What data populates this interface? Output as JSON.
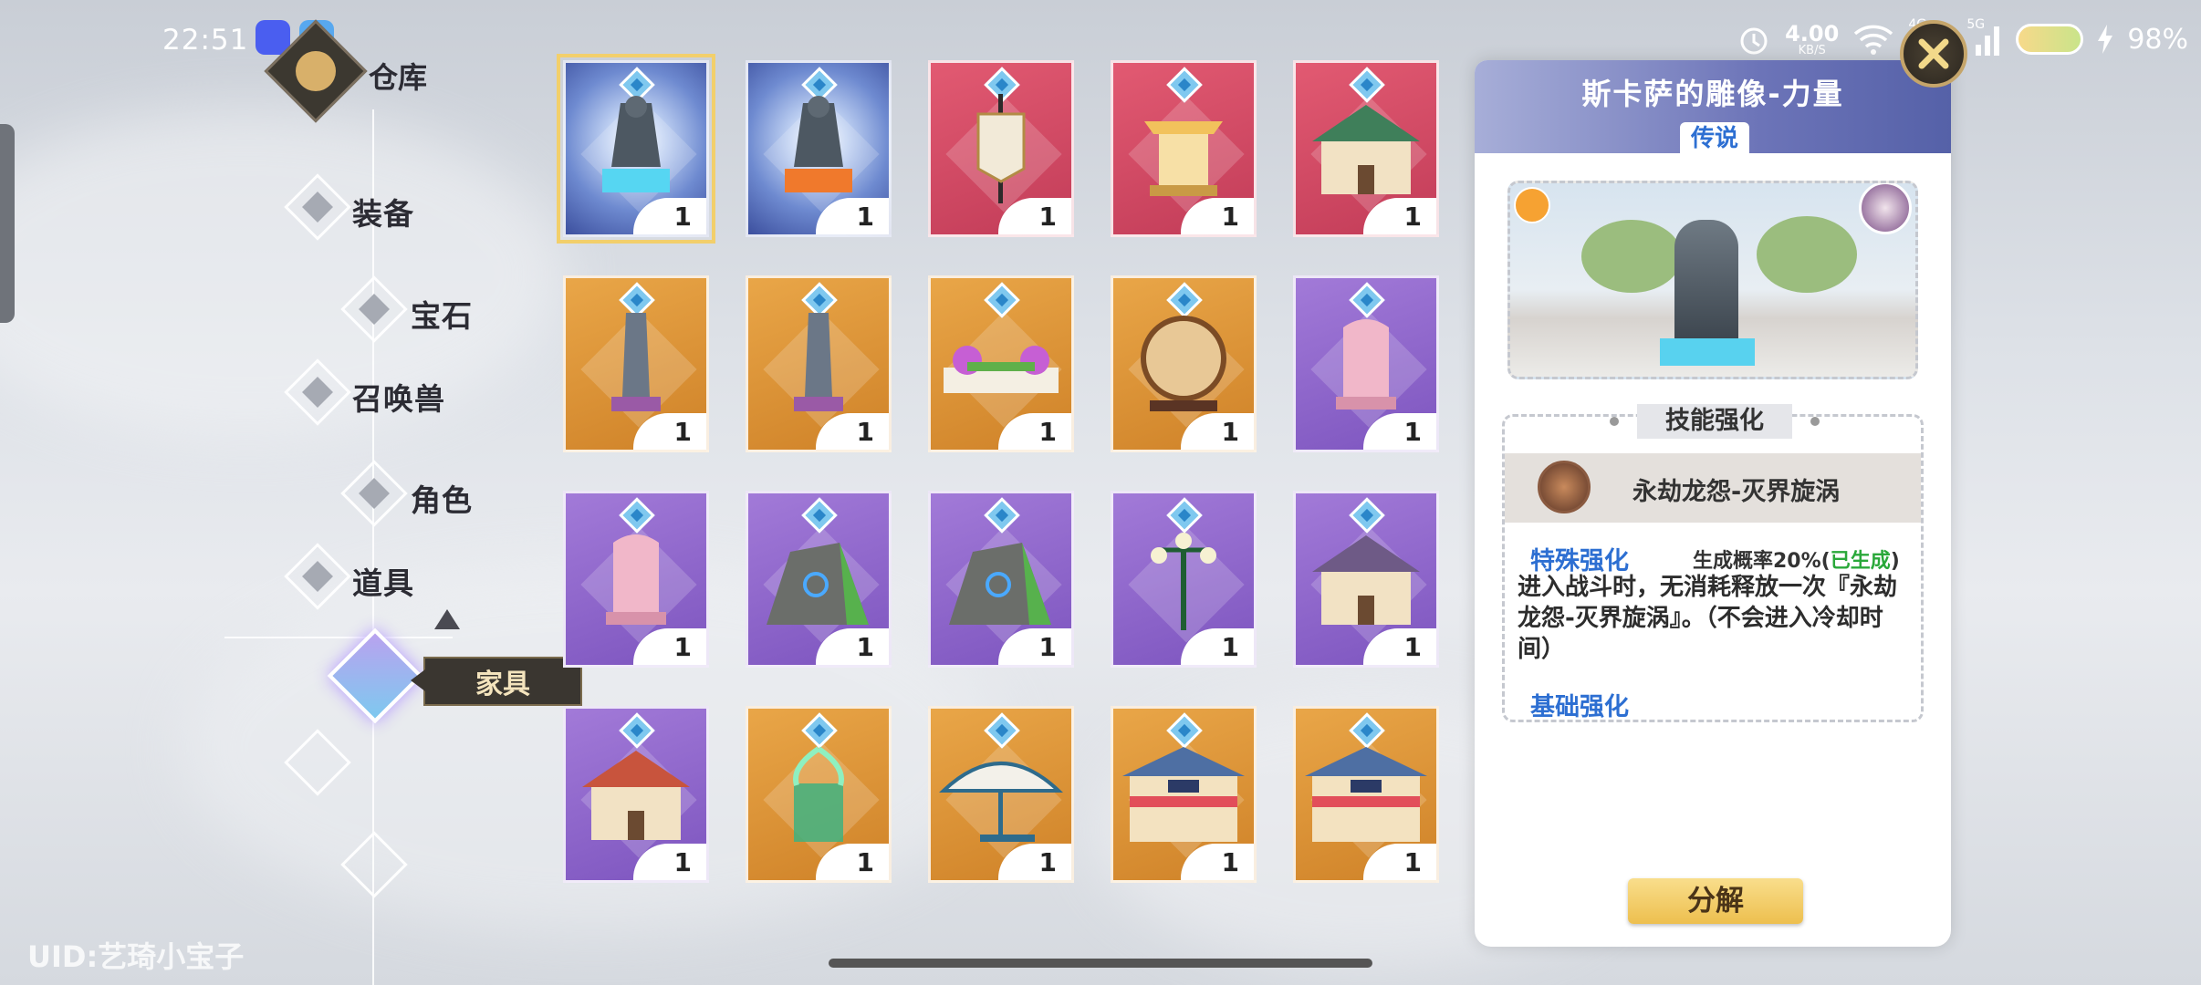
{
  "status_bar": {
    "time": "22:51",
    "net_speed": "4.00",
    "net_unit": "KB/S",
    "net_4g": "4G",
    "net_5g": "5G",
    "battery": "98%"
  },
  "header": {
    "title": "仓库"
  },
  "nav": {
    "items": [
      {
        "label": "装备"
      },
      {
        "label": "宝石"
      },
      {
        "label": "召唤兽"
      },
      {
        "label": "角色"
      },
      {
        "label": "道具"
      },
      {
        "label": "家具"
      }
    ],
    "active": "家具"
  },
  "uid": "UID:艺琦小宝子",
  "inventory": [
    {
      "art": "statue-blue-icon",
      "rarity": "blue",
      "qty": "1"
    },
    {
      "art": "statue-orange-icon",
      "rarity": "blue",
      "qty": "1"
    },
    {
      "art": "banner-icon",
      "rarity": "red",
      "qty": "1"
    },
    {
      "art": "shrine-icon",
      "rarity": "red",
      "qty": "1"
    },
    {
      "art": "mansion-icon",
      "rarity": "red",
      "qty": "1"
    },
    {
      "art": "obelisk-icon",
      "rarity": "orange",
      "qty": "1"
    },
    {
      "art": "obelisk-icon",
      "rarity": "orange",
      "qty": "1"
    },
    {
      "art": "flowerbed-icon",
      "rarity": "orange",
      "qty": "1"
    },
    {
      "art": "gong-icon",
      "rarity": "orange",
      "qty": "1"
    },
    {
      "art": "pink-stone-icon",
      "rarity": "purple",
      "qty": "1"
    },
    {
      "art": "pink-stone-icon",
      "rarity": "purple",
      "qty": "1"
    },
    {
      "art": "rune-rock-icon",
      "rarity": "purple",
      "qty": "1"
    },
    {
      "art": "rune-rock-icon",
      "rarity": "purple",
      "qty": "1"
    },
    {
      "art": "street-lamp-icon",
      "rarity": "purple",
      "qty": "1"
    },
    {
      "art": "house-icon",
      "rarity": "purple",
      "qty": "1"
    },
    {
      "art": "red-house-icon",
      "rarity": "purple",
      "qty": "1"
    },
    {
      "art": "fountain-icon",
      "rarity": "orange",
      "qty": "1"
    },
    {
      "art": "parasol-icon",
      "rarity": "orange",
      "qty": "1"
    },
    {
      "art": "shop-icon",
      "rarity": "orange",
      "qty": "1"
    },
    {
      "art": "shop-icon",
      "rarity": "orange",
      "qty": "1"
    }
  ],
  "detail": {
    "title": "斯卡萨的雕像-力量",
    "rarity": "传说",
    "skill_header": "技能强化",
    "skill_name": "永劫龙怨-灭界旋涡",
    "special_label": "特殊强化",
    "chance_prefix": "生成概率20%(",
    "chance_status": "已生成",
    "chance_suffix": ")",
    "description": "进入战斗时，无消耗释放一次『永劫龙怨-灭界旋涡』。（不会进入冷却时间）",
    "basic_label": "基础强化",
    "decompose_button": "分解"
  },
  "colors": {
    "blue": "#6e8ad0",
    "red": "#d04a64",
    "orange": "#e09a3c",
    "purple": "#9068cc",
    "accent_blue": "#2d6fd2",
    "done_green": "#2aa83a"
  }
}
